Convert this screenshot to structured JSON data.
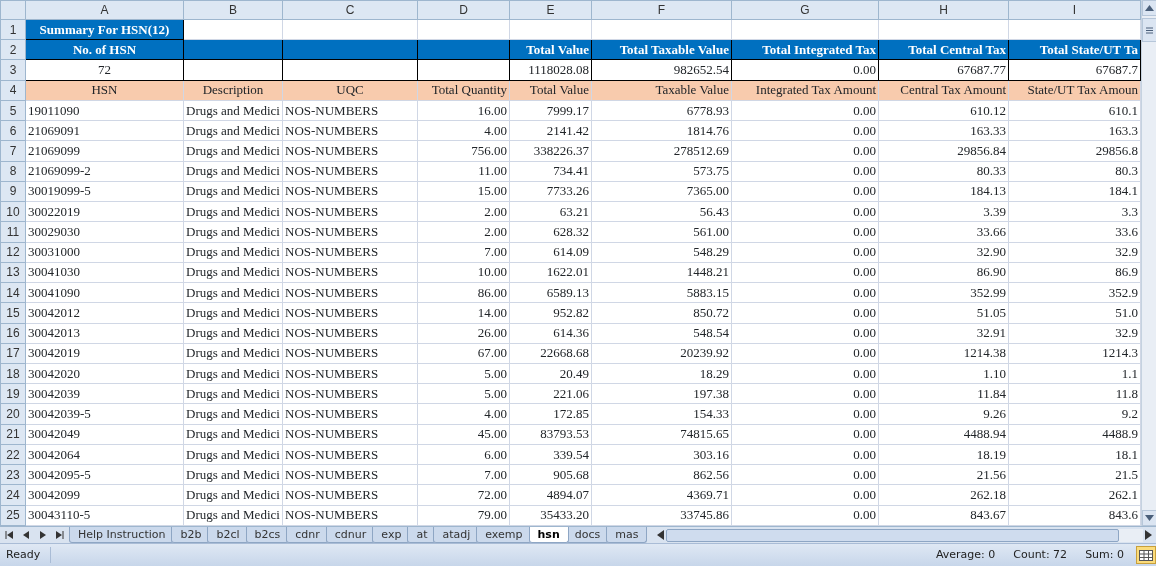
{
  "column_letters": [
    "A",
    "B",
    "C",
    "D",
    "E",
    "F",
    "G",
    "H",
    "I"
  ],
  "row_numbers": [
    "1",
    "2",
    "3",
    "4",
    "5",
    "6",
    "7",
    "8",
    "9",
    "10",
    "11",
    "12",
    "13",
    "14",
    "15",
    "16",
    "17",
    "18",
    "19",
    "20",
    "21",
    "22",
    "23",
    "24",
    "25"
  ],
  "title": "Summary For HSN(12)",
  "summary": [
    {
      "kind": "count",
      "label": "No. of HSN",
      "value": "72"
    },
    {
      "kind": "blank"
    },
    {
      "kind": "blank"
    },
    {
      "kind": "blank"
    },
    {
      "kind": "amount",
      "label": "Total Value",
      "value": "1118028.08"
    },
    {
      "kind": "amount",
      "label": "Total Taxable Value",
      "value": "982652.54"
    },
    {
      "kind": "amount",
      "label": "Total Integrated Tax",
      "value": "0.00"
    },
    {
      "kind": "amount",
      "label": "Total Central Tax",
      "value": "67687.77"
    },
    {
      "kind": "amount",
      "label": "Total State/UT Ta",
      "value": "67687.7"
    }
  ],
  "table": {
    "columns": [
      {
        "label": "HSN",
        "kind": "text"
      },
      {
        "label": "Description",
        "kind": "text"
      },
      {
        "label": "UQC",
        "kind": "text"
      },
      {
        "label": "Total Quantity",
        "kind": "number"
      },
      {
        "label": "Total Value",
        "kind": "number"
      },
      {
        "label": "Taxable Value",
        "kind": "number"
      },
      {
        "label": "Integrated Tax Amount",
        "kind": "number"
      },
      {
        "label": "Central Tax Amount",
        "kind": "number"
      },
      {
        "label": "State/UT Tax Amoun",
        "kind": "number"
      }
    ],
    "rows": [
      [
        "19011090",
        "Drugs and Medici",
        "NOS-NUMBERS",
        "16.00",
        "7999.17",
        "6778.93",
        "0.00",
        "610.12",
        "610.1"
      ],
      [
        "21069091",
        "Drugs and Medici",
        "NOS-NUMBERS",
        "4.00",
        "2141.42",
        "1814.76",
        "0.00",
        "163.33",
        "163.3"
      ],
      [
        "21069099",
        "Drugs and Medici",
        "NOS-NUMBERS",
        "756.00",
        "338226.37",
        "278512.69",
        "0.00",
        "29856.84",
        "29856.8"
      ],
      [
        "21069099-2",
        "Drugs and Medici",
        "NOS-NUMBERS",
        "11.00",
        "734.41",
        "573.75",
        "0.00",
        "80.33",
        "80.3"
      ],
      [
        "30019099-5",
        "Drugs and Medici",
        "NOS-NUMBERS",
        "15.00",
        "7733.26",
        "7365.00",
        "0.00",
        "184.13",
        "184.1"
      ],
      [
        "30022019",
        "Drugs and Medici",
        "NOS-NUMBERS",
        "2.00",
        "63.21",
        "56.43",
        "0.00",
        "3.39",
        "3.3"
      ],
      [
        "30029030",
        "Drugs and Medici",
        "NOS-NUMBERS",
        "2.00",
        "628.32",
        "561.00",
        "0.00",
        "33.66",
        "33.6"
      ],
      [
        "30031000",
        "Drugs and Medici",
        "NOS-NUMBERS",
        "7.00",
        "614.09",
        "548.29",
        "0.00",
        "32.90",
        "32.9"
      ],
      [
        "30041030",
        "Drugs and Medici",
        "NOS-NUMBERS",
        "10.00",
        "1622.01",
        "1448.21",
        "0.00",
        "86.90",
        "86.9"
      ],
      [
        "30041090",
        "Drugs and Medici",
        "NOS-NUMBERS",
        "86.00",
        "6589.13",
        "5883.15",
        "0.00",
        "352.99",
        "352.9"
      ],
      [
        "30042012",
        "Drugs and Medici",
        "NOS-NUMBERS",
        "14.00",
        "952.82",
        "850.72",
        "0.00",
        "51.05",
        "51.0"
      ],
      [
        "30042013",
        "Drugs and Medici",
        "NOS-NUMBERS",
        "26.00",
        "614.36",
        "548.54",
        "0.00",
        "32.91",
        "32.9"
      ],
      [
        "30042019",
        "Drugs and Medici",
        "NOS-NUMBERS",
        "67.00",
        "22668.68",
        "20239.92",
        "0.00",
        "1214.38",
        "1214.3"
      ],
      [
        "30042020",
        "Drugs and Medici",
        "NOS-NUMBERS",
        "5.00",
        "20.49",
        "18.29",
        "0.00",
        "1.10",
        "1.1"
      ],
      [
        "30042039",
        "Drugs and Medici",
        "NOS-NUMBERS",
        "5.00",
        "221.06",
        "197.38",
        "0.00",
        "11.84",
        "11.8"
      ],
      [
        "30042039-5",
        "Drugs and Medici",
        "NOS-NUMBERS",
        "4.00",
        "172.85",
        "154.33",
        "0.00",
        "9.26",
        "9.2"
      ],
      [
        "30042049",
        "Drugs and Medici",
        "NOS-NUMBERS",
        "45.00",
        "83793.53",
        "74815.65",
        "0.00",
        "4488.94",
        "4488.9"
      ],
      [
        "30042064",
        "Drugs and Medici",
        "NOS-NUMBERS",
        "6.00",
        "339.54",
        "303.16",
        "0.00",
        "18.19",
        "18.1"
      ],
      [
        "30042095-5",
        "Drugs and Medici",
        "NOS-NUMBERS",
        "7.00",
        "905.68",
        "862.56",
        "0.00",
        "21.56",
        "21.5"
      ],
      [
        "30042099",
        "Drugs and Medici",
        "NOS-NUMBERS",
        "72.00",
        "4894.07",
        "4369.71",
        "0.00",
        "262.18",
        "262.1"
      ],
      [
        "30043110-5",
        "Drugs and Medici",
        "NOS-NUMBERS",
        "79.00",
        "35433.20",
        "33745.86",
        "0.00",
        "843.67",
        "843.6"
      ]
    ]
  },
  "sheet_tabs": [
    {
      "label": "Help Instruction",
      "selected": false
    },
    {
      "label": "b2b",
      "selected": false
    },
    {
      "label": "b2cl",
      "selected": false
    },
    {
      "label": "b2cs",
      "selected": false
    },
    {
      "label": "cdnr",
      "selected": false
    },
    {
      "label": "cdnur",
      "selected": false
    },
    {
      "label": "exp",
      "selected": false
    },
    {
      "label": "at",
      "selected": false
    },
    {
      "label": "atadj",
      "selected": false
    },
    {
      "label": "exemp",
      "selected": false
    },
    {
      "label": "hsn",
      "selected": true
    },
    {
      "label": "docs",
      "selected": false
    },
    {
      "label": "mas",
      "selected": false
    }
  ],
  "status_bar": {
    "mode": "Ready",
    "average": "Average: 0",
    "count": "Count: 72",
    "sum": "Sum: 0"
  }
}
